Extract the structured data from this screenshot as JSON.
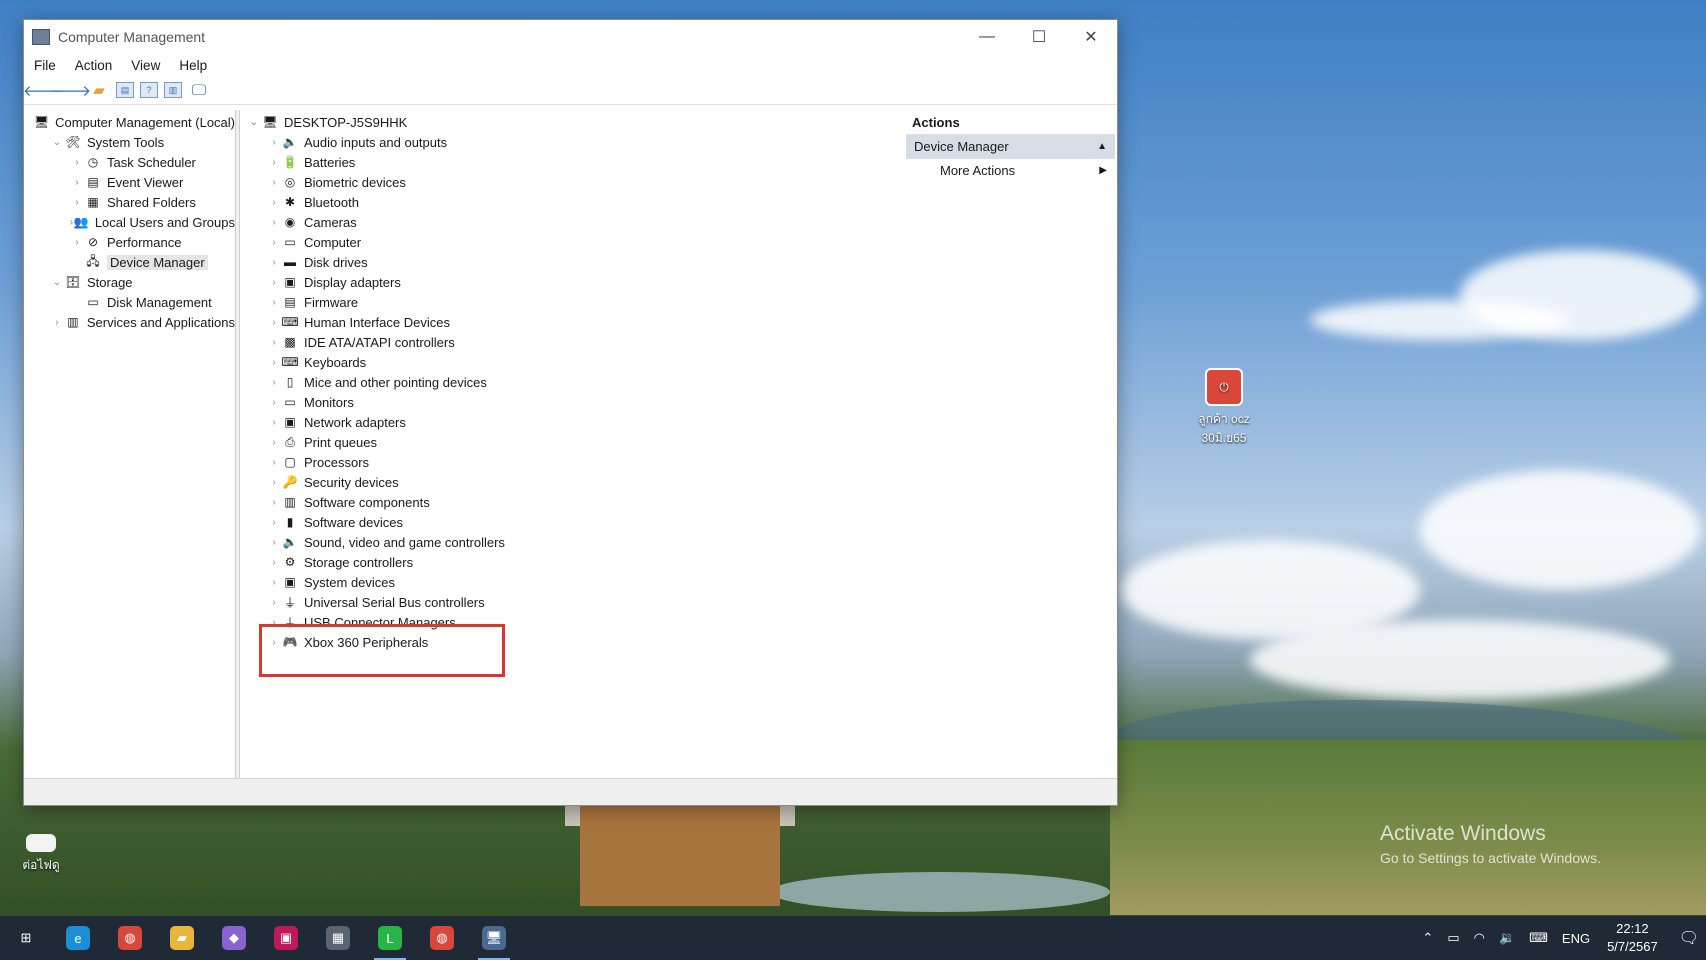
{
  "window": {
    "title": "Computer Management",
    "controls": {
      "minimize": "—",
      "maximize": "☐",
      "close": "✕"
    }
  },
  "menu": [
    "File",
    "Action",
    "View",
    "Help"
  ],
  "toolbar": {
    "icons": [
      "back-arrow-icon",
      "forward-arrow-icon",
      "up-folder-icon",
      "show-hide-tree-icon",
      "help-icon",
      "properties-icon",
      "monitor-icon"
    ]
  },
  "left_tree": [
    {
      "label": "Computer Management (Local)",
      "indent": 0,
      "expander": "",
      "icon": "computer-management-icon",
      "glyph": "🖥"
    },
    {
      "label": "System Tools",
      "indent": 1,
      "expander": "⌄",
      "icon": "system-tools-icon",
      "glyph": "🛠"
    },
    {
      "label": "Task Scheduler",
      "indent": 2,
      "expander": "›",
      "icon": "clock-icon",
      "glyph": "◷"
    },
    {
      "label": "Event Viewer",
      "indent": 2,
      "expander": "›",
      "icon": "event-viewer-icon",
      "glyph": "▤"
    },
    {
      "label": "Shared Folders",
      "indent": 2,
      "expander": "›",
      "icon": "shared-folder-icon",
      "glyph": "▦"
    },
    {
      "label": "Local Users and Groups",
      "indent": 2,
      "expander": "›",
      "icon": "users-icon",
      "glyph": "👥"
    },
    {
      "label": "Performance",
      "indent": 2,
      "expander": "›",
      "icon": "performance-icon",
      "glyph": "⊘"
    },
    {
      "label": "Device Manager",
      "indent": 2,
      "expander": "",
      "icon": "device-manager-icon",
      "glyph": "🖧",
      "selected": true
    },
    {
      "label": "Storage",
      "indent": 1,
      "expander": "⌄",
      "icon": "storage-icon",
      "glyph": "🗄"
    },
    {
      "label": "Disk Management",
      "indent": 2,
      "expander": "",
      "icon": "disk-management-icon",
      "glyph": "▭"
    },
    {
      "label": "Services and Applications",
      "indent": 1,
      "expander": "›",
      "icon": "services-icon",
      "glyph": "▥"
    }
  ],
  "device_tree": {
    "root": {
      "label": "DESKTOP-J5S9HHK",
      "icon": "computer-icon"
    },
    "categories": [
      {
        "label": "Audio inputs and outputs",
        "icon": "speaker-icon",
        "glyph": "🔈"
      },
      {
        "label": "Batteries",
        "icon": "battery-icon",
        "glyph": "🔋"
      },
      {
        "label": "Biometric devices",
        "icon": "fingerprint-icon",
        "glyph": "◎"
      },
      {
        "label": "Bluetooth",
        "icon": "bluetooth-icon",
        "glyph": "✱"
      },
      {
        "label": "Cameras",
        "icon": "camera-icon",
        "glyph": "◉"
      },
      {
        "label": "Computer",
        "icon": "monitor-icon",
        "glyph": "▭"
      },
      {
        "label": "Disk drives",
        "icon": "disk-drive-icon",
        "glyph": "▬"
      },
      {
        "label": "Display adapters",
        "icon": "display-adapter-icon",
        "glyph": "▣"
      },
      {
        "label": "Firmware",
        "icon": "firmware-icon",
        "glyph": "▤"
      },
      {
        "label": "Human Interface Devices",
        "icon": "hid-icon",
        "glyph": "⌨"
      },
      {
        "label": "IDE ATA/ATAPI controllers",
        "icon": "ide-controller-icon",
        "glyph": "▩"
      },
      {
        "label": "Keyboards",
        "icon": "keyboard-icon",
        "glyph": "⌨"
      },
      {
        "label": "Mice and other pointing devices",
        "icon": "mouse-icon",
        "glyph": "▯"
      },
      {
        "label": "Monitors",
        "icon": "monitor-icon",
        "glyph": "▭"
      },
      {
        "label": "Network adapters",
        "icon": "network-adapter-icon",
        "glyph": "▣"
      },
      {
        "label": "Print queues",
        "icon": "printer-icon",
        "glyph": "⎙"
      },
      {
        "label": "Processors",
        "icon": "processor-icon",
        "glyph": "▢"
      },
      {
        "label": "Security devices",
        "icon": "security-device-icon",
        "glyph": "🔑"
      },
      {
        "label": "Software components",
        "icon": "software-component-icon",
        "glyph": "▥"
      },
      {
        "label": "Software devices",
        "icon": "software-device-icon",
        "glyph": "▮"
      },
      {
        "label": "Sound, video and game controllers",
        "icon": "sound-icon",
        "glyph": "🔈"
      },
      {
        "label": "Storage controllers",
        "icon": "storage-controller-icon",
        "glyph": "⚙"
      },
      {
        "label": "System devices",
        "icon": "system-device-icon",
        "glyph": "▣"
      },
      {
        "label": "Universal Serial Bus controllers",
        "icon": "usb-icon",
        "glyph": "⏚"
      },
      {
        "label": "USB Connector Managers",
        "icon": "usb-connector-icon",
        "glyph": "⏚"
      },
      {
        "label": "Xbox 360 Peripherals",
        "icon": "gamepad-icon",
        "glyph": "🎮"
      }
    ]
  },
  "actions": {
    "header": "Actions",
    "section": "Device Manager",
    "item": "More Actions"
  },
  "desktop": {
    "icons": [
      {
        "label1": "ลูกค้า ocz",
        "label2": "30มิ.ย65",
        "icon": "power-icon"
      },
      {
        "label1": "ต่อไฟดู",
        "label2": "",
        "icon": "file-icon"
      }
    ],
    "watermark": {
      "line1": "Activate Windows",
      "line2": "Go to Settings to activate Windows."
    }
  },
  "taskbar": {
    "apps": [
      {
        "name": "start-button",
        "glyph": "⊞",
        "color": "#1f2a36"
      },
      {
        "name": "edge-app",
        "glyph": "e",
        "color": "#1b8fd6"
      },
      {
        "name": "chrome-app",
        "glyph": "◍",
        "color": "#d9473a"
      },
      {
        "name": "file-explorer-app",
        "glyph": "▰",
        "color": "#e8b63a"
      },
      {
        "name": "color-app",
        "glyph": "◆",
        "color": "#8a63d2"
      },
      {
        "name": "media-app",
        "glyph": "▣",
        "color": "#c2185b"
      },
      {
        "name": "calculator-app",
        "glyph": "▦",
        "color": "#5b6470"
      },
      {
        "name": "line-app",
        "glyph": "L",
        "color": "#28b446"
      },
      {
        "name": "chrome-profile-app",
        "glyph": "◍",
        "color": "#d9473a"
      },
      {
        "name": "computer-management-app",
        "glyph": "🖥",
        "color": "#4a6a92"
      }
    ],
    "language": "ENG",
    "time": "22:12",
    "date": "5/7/2567"
  }
}
